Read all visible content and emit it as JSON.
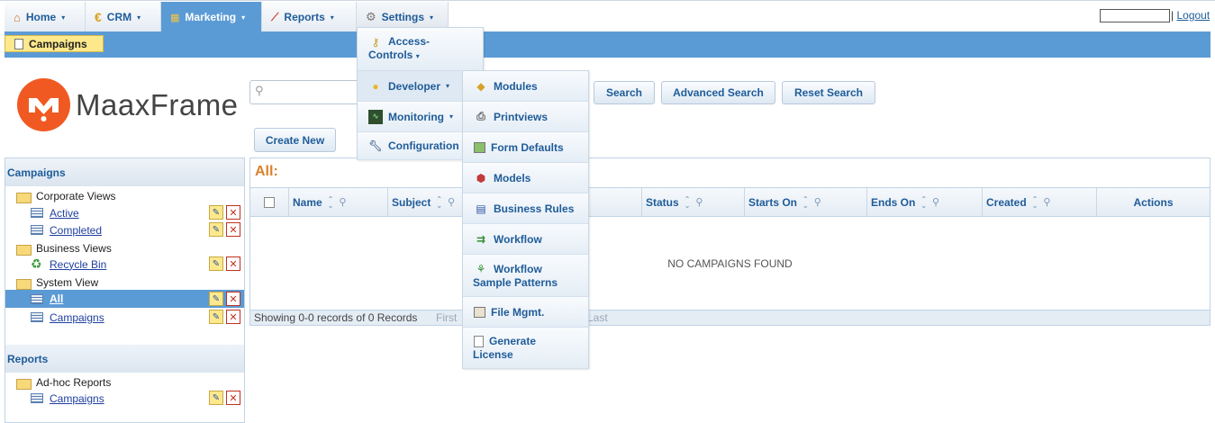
{
  "nav": {
    "home": "Home",
    "crm": "CRM",
    "marketing": "Marketing",
    "reports": "Reports",
    "settings": "Settings",
    "logout": "Logout",
    "logout_sep": "|"
  },
  "subbar": {
    "current_tab": "Campaigns"
  },
  "logo": {
    "text": "MaaxFrame"
  },
  "search": {
    "placeholder": "",
    "search_label": "Search",
    "advanced_label": "Advanced Search",
    "reset_label": "Reset Search"
  },
  "create_new": "Create New",
  "left_panel": {
    "campaigns_header": "Campaigns",
    "tree": {
      "corporate_views": "Corporate Views",
      "active": "Active",
      "completed": "Completed",
      "business_views": "Business Views",
      "recycle_bin": "Recycle Bin",
      "system_view": "System View",
      "all": "All",
      "campaigns": "Campaigns"
    },
    "reports_header": "Reports",
    "reports_tree": {
      "adhoc": "Ad-hoc Reports",
      "campaigns": "Campaigns"
    }
  },
  "grid": {
    "title": "All:",
    "columns": [
      "Name",
      "Subject",
      "Status",
      "Starts On",
      "Ends On",
      "Created",
      "Actions"
    ],
    "empty_message": "NO CAMPAIGNS FOUND",
    "footer_text": "Showing 0-0 records of 0 Records",
    "pager_first": "First",
    "pager_last": "Last"
  },
  "settings_menu": {
    "access_controls_1": "Access-",
    "access_controls_2": "Controls",
    "developer": "Developer",
    "monitoring": "Monitoring",
    "configuration": "Configuration"
  },
  "developer_menu": {
    "modules": "Modules",
    "printviews": "Printviews",
    "form_defaults": "Form Defaults",
    "models": "Models",
    "business_rules": "Business Rules",
    "workflow": "Workflow",
    "workflow_sample_1": "Workflow",
    "workflow_sample_2": "Sample Patterns",
    "file_mgmt": "File Mgmt.",
    "generate_license_1": "Generate",
    "generate_license_2": "License"
  },
  "colors": {
    "accent_blue": "#5b9bd5",
    "link_blue": "#1f5c99",
    "logo_orange": "#f05a22",
    "title_orange": "#d9822b",
    "highlight_yellow": "#fde98c"
  }
}
